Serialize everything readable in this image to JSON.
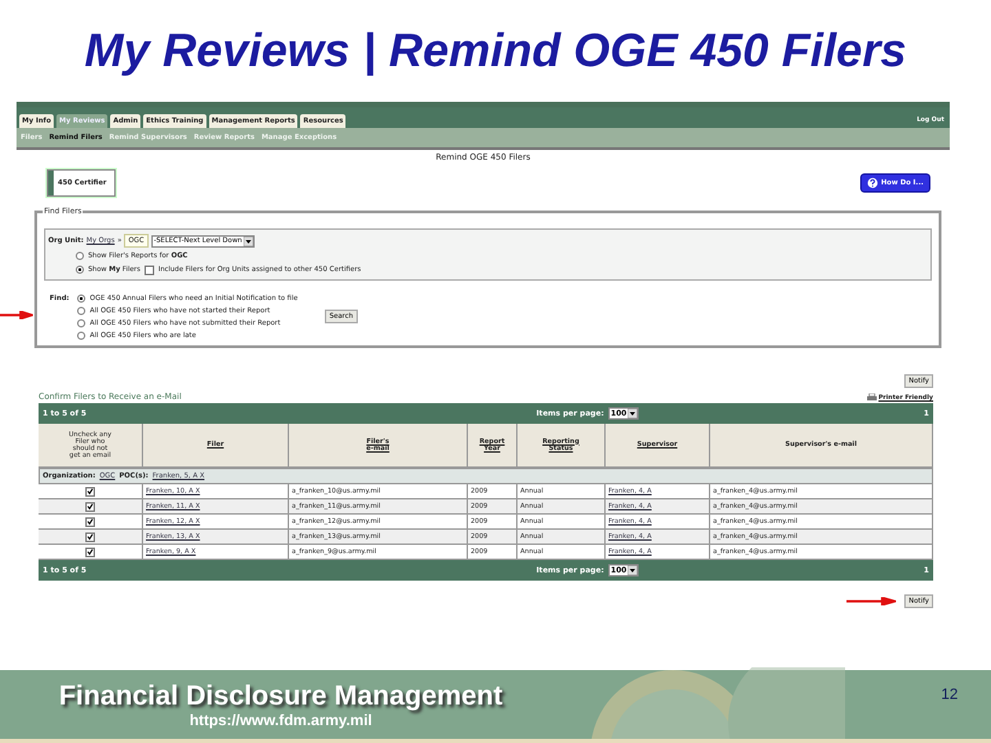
{
  "title": "My Reviews | Remind OGE 450 Filers",
  "nav": {
    "tabs": [
      {
        "label": "My Info",
        "selected": false
      },
      {
        "label": "My Reviews",
        "selected": true
      },
      {
        "label": "Admin",
        "selected": false
      },
      {
        "label": "Ethics Training",
        "selected": false
      },
      {
        "label": "Management Reports",
        "selected": false
      },
      {
        "label": "Resources",
        "selected": false
      }
    ],
    "logout": "Log Out"
  },
  "subnav": [
    {
      "label": "Filers",
      "selected": false
    },
    {
      "label": "Remind Filers",
      "selected": true
    },
    {
      "label": "Remind Supervisors",
      "selected": false
    },
    {
      "label": "Review Reports",
      "selected": false
    },
    {
      "label": "Manage Exceptions",
      "selected": false
    }
  ],
  "page_heading": "Remind OGE 450 Filers",
  "role_badge": "450 Certifier",
  "help_button": "How Do I...",
  "find_filers": {
    "legend": "Find Filers",
    "org_label": "Org Unit:",
    "breadcrumb": "My Orgs",
    "separator": "»",
    "org": "OGC",
    "select": "-SELECT-Next Level Down",
    "scope_options": [
      {
        "label": "Show Filer's Reports for **OGC**",
        "selected": false
      },
      {
        "label": "Show **My** Filers",
        "selected": true
      }
    ],
    "include_option": {
      "label": "Include Filers for Org Units assigned to other 450 Certifiers",
      "checked": false
    },
    "find_label": "Find:",
    "find_options": [
      {
        "label": "OGE 450 Annual Filers who need an Initial Notification to file",
        "selected": true
      },
      {
        "label": "All OGE 450 Filers who have not started their Report",
        "selected": false
      },
      {
        "label": "All OGE 450 Filers who have not submitted their Report",
        "selected": false
      },
      {
        "label": "All OGE 450 Filers who are late",
        "selected": false
      }
    ],
    "search_button": "Search"
  },
  "confirm": {
    "title": "Confirm Filers to Receive an e-Mail",
    "notify_top": "Notify",
    "printer_friendly": "Printer Friendly",
    "pager_top": {
      "range": "1 to 5 of 5",
      "items_label": "Items per page:",
      "per_page": "100",
      "page": "1"
    },
    "columns": [
      "Uncheck any\nFiler who\nshould not\nget an email",
      "Filer",
      "Filer's\ne-mail",
      "Report\nYear",
      "Reporting\nStatus",
      "Supervisor",
      "Supervisor's e-mail"
    ],
    "org_row": {
      "label": "Organization:",
      "org": "OGC",
      "poc_label": "POC(s):",
      "poc": "Franken, 5, A X"
    },
    "rows": [
      {
        "checked": true,
        "filer": "Franken, 10, A X",
        "email": "a_franken_10@us.army.mil",
        "year": "2009",
        "status": "Annual",
        "supervisor": "Franken, 4, A",
        "supervisor_email": "a_franken_4@us.army.mil"
      },
      {
        "checked": true,
        "filer": "Franken, 11, A X",
        "email": "a_franken_11@us.army.mil",
        "year": "2009",
        "status": "Annual",
        "supervisor": "Franken, 4, A",
        "supervisor_email": "a_franken_4@us.army.mil"
      },
      {
        "checked": true,
        "filer": "Franken, 12, A X",
        "email": "a_franken_12@us.army.mil",
        "year": "2009",
        "status": "Annual",
        "supervisor": "Franken, 4, A",
        "supervisor_email": "a_franken_4@us.army.mil"
      },
      {
        "checked": true,
        "filer": "Franken, 13, A X",
        "email": "a_franken_13@us.army.mil",
        "year": "2009",
        "status": "Annual",
        "supervisor": "Franken, 4, A",
        "supervisor_email": "a_franken_4@us.army.mil"
      },
      {
        "checked": true,
        "filer": "Franken, 9, A X",
        "email": "a_franken_9@us.army.mil",
        "year": "2009",
        "status": "Annual",
        "supervisor": "Franken, 4, A",
        "supervisor_email": "a_franken_4@us.army.mil"
      }
    ],
    "pager_bottom": {
      "range": "1 to 5 of 5",
      "items_label": "Items per page:",
      "per_page": "100",
      "page": "1"
    },
    "notify_bottom": "Notify"
  },
  "footer": {
    "brand": "Financial Disclosure Management",
    "url": "https://www.fdm.army.mil",
    "page_number": "12"
  }
}
